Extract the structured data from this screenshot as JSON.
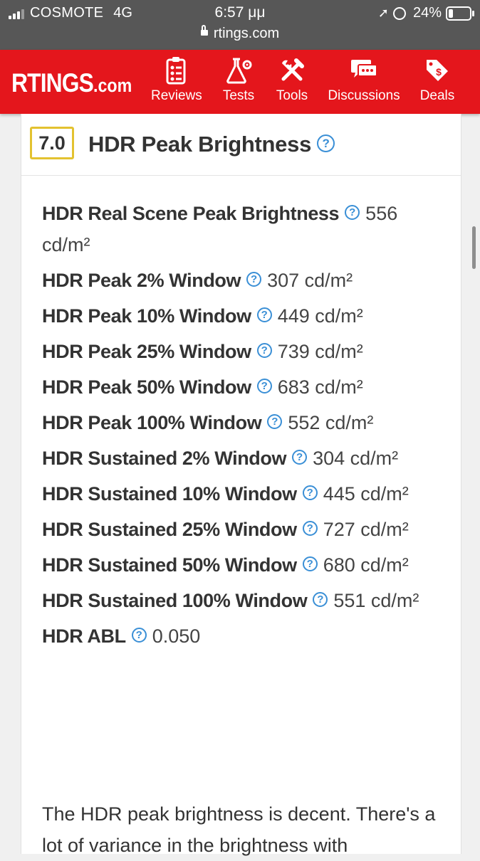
{
  "status_bar": {
    "carrier": "COSMOTE",
    "network": "4G",
    "time": "6:57 μμ",
    "battery": "24%",
    "battery_level": 0.24
  },
  "url": "rtings.com",
  "header": {
    "logo_main": "RTINGS",
    "logo_suffix": ".com",
    "brand_color": "#e4161c",
    "nav": [
      {
        "label": "Reviews",
        "icon": "clipboard-icon"
      },
      {
        "label": "Tests",
        "icon": "flask-icon"
      },
      {
        "label": "Tools",
        "icon": "tools-icon"
      },
      {
        "label": "Discussions",
        "icon": "chat-icon"
      },
      {
        "label": "Deals",
        "icon": "price-tag-icon"
      }
    ]
  },
  "section": {
    "score": "7.0",
    "title": "HDR Peak Brightness",
    "help_icon": "question-icon"
  },
  "specs": [
    {
      "name": "HDR Real Scene Peak Brightness",
      "value": "556 cd/m²"
    },
    {
      "name": "HDR Peak 2% Window",
      "value": "307 cd/m²"
    },
    {
      "name": "HDR Peak 10% Window",
      "value": "449 cd/m²"
    },
    {
      "name": "HDR Peak 25% Window",
      "value": "739 cd/m²"
    },
    {
      "name": "HDR Peak 50% Window",
      "value": "683 cd/m²"
    },
    {
      "name": "HDR Peak 100% Window",
      "value": "552 cd/m²"
    },
    {
      "name": "HDR Sustained 2% Window",
      "value": "304 cd/m²"
    },
    {
      "name": "HDR Sustained 10% Window",
      "value": "445 cd/m²"
    },
    {
      "name": "HDR Sustained 25% Window",
      "value": "727 cd/m²"
    },
    {
      "name": "HDR Sustained 50% Window",
      "value": "680 cd/m²"
    },
    {
      "name": "HDR Sustained 100% Window",
      "value": "551 cd/m²"
    },
    {
      "name": "HDR ABL",
      "value": "0.050"
    }
  ],
  "description": "The HDR peak brightness is decent. There's a lot of variance in the brightness with"
}
